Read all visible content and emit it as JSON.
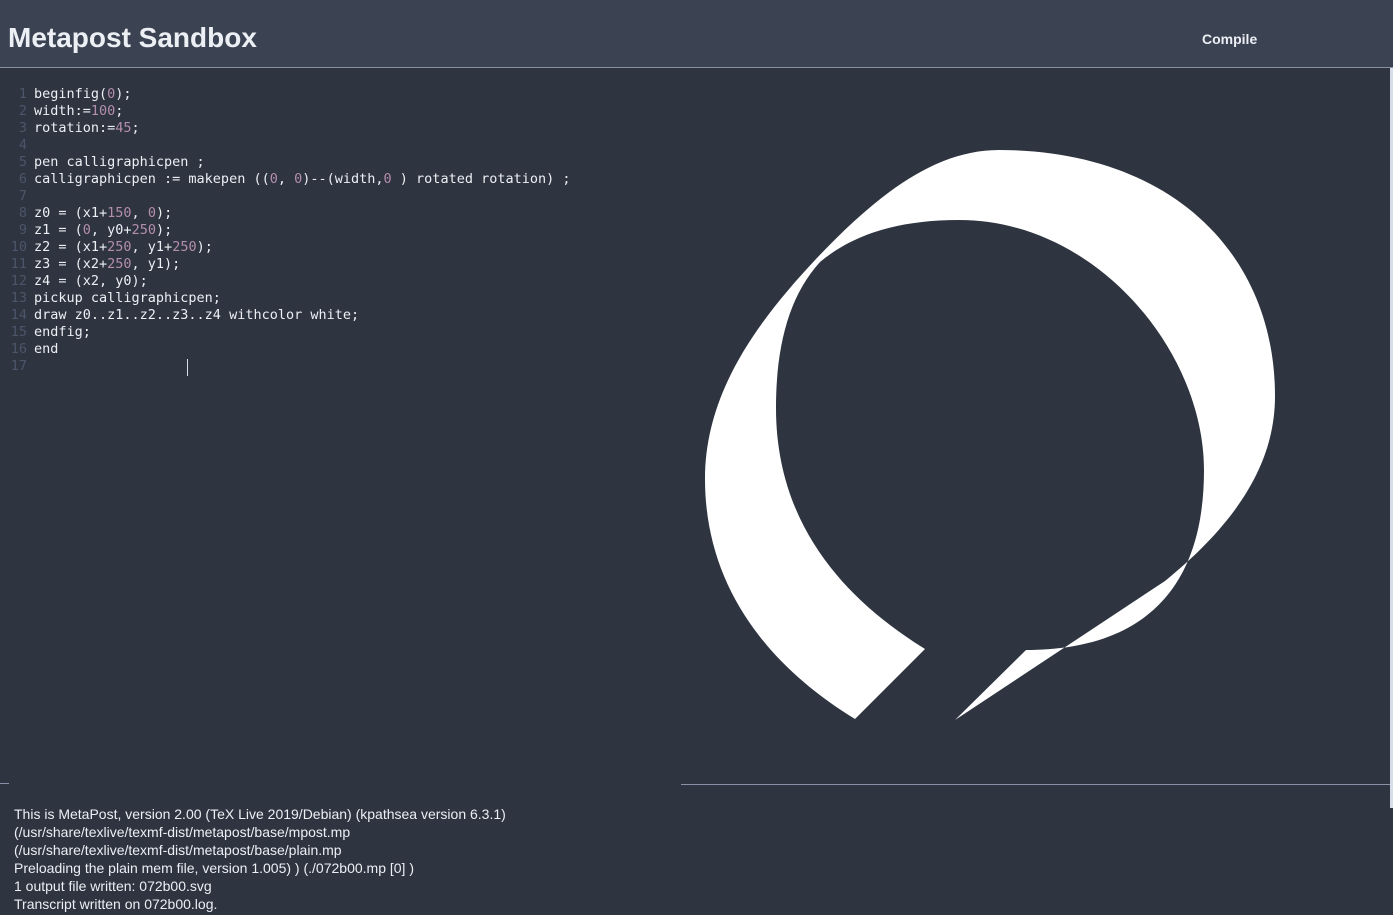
{
  "header": {
    "title": "Metapost Sandbox",
    "compile_label": "Compile"
  },
  "editor": {
    "lines": [
      {
        "n": "1",
        "parts": [
          [
            "beginfig(",
            "t"
          ],
          [
            "0",
            "n"
          ],
          [
            ");",
            "t"
          ]
        ]
      },
      {
        "n": "2",
        "parts": [
          [
            "width:=",
            "t"
          ],
          [
            "100",
            "n"
          ],
          [
            ";",
            "t"
          ]
        ]
      },
      {
        "n": "3",
        "parts": [
          [
            "rotation:=",
            "t"
          ],
          [
            "45",
            "n"
          ],
          [
            ";",
            "t"
          ]
        ]
      },
      {
        "n": "4",
        "parts": []
      },
      {
        "n": "5",
        "parts": [
          [
            "pen calligraphicpen ;",
            "t"
          ]
        ]
      },
      {
        "n": "6",
        "parts": [
          [
            "calligraphicpen := makepen ((",
            "t"
          ],
          [
            "0",
            "n"
          ],
          [
            ", ",
            "t"
          ],
          [
            "0",
            "n"
          ],
          [
            ")--(width,",
            "t"
          ],
          [
            "0",
            "n"
          ],
          [
            " ) rotated rotation) ;",
            "t"
          ]
        ]
      },
      {
        "n": "7",
        "parts": []
      },
      {
        "n": "8",
        "parts": [
          [
            "z0 = (x1+",
            "t"
          ],
          [
            "150",
            "n"
          ],
          [
            ", ",
            "t"
          ],
          [
            "0",
            "n"
          ],
          [
            ");",
            "t"
          ]
        ]
      },
      {
        "n": "9",
        "parts": [
          [
            "z1 = (",
            "t"
          ],
          [
            "0",
            "n"
          ],
          [
            ", y0+",
            "t"
          ],
          [
            "250",
            "n"
          ],
          [
            ");",
            "t"
          ]
        ]
      },
      {
        "n": "10",
        "parts": [
          [
            "z2 = (x1+",
            "t"
          ],
          [
            "250",
            "n"
          ],
          [
            ", y1+",
            "t"
          ],
          [
            "250",
            "n"
          ],
          [
            ");",
            "t"
          ]
        ]
      },
      {
        "n": "11",
        "parts": [
          [
            "z3 = (x2+",
            "t"
          ],
          [
            "250",
            "n"
          ],
          [
            ", y1);",
            "t"
          ]
        ]
      },
      {
        "n": "12",
        "parts": [
          [
            "z4 = (x2, y0);",
            "t"
          ]
        ]
      },
      {
        "n": "13",
        "parts": [
          [
            "pickup calligraphicpen;",
            "t"
          ]
        ]
      },
      {
        "n": "14",
        "parts": [
          [
            "draw z0..z1..z2..z3..z4 withcolor white;",
            "t"
          ]
        ]
      },
      {
        "n": "15",
        "parts": [
          [
            "endfig;",
            "t"
          ]
        ]
      },
      {
        "n": "16",
        "parts": [
          [
            "end",
            "t"
          ]
        ]
      },
      {
        "n": "17",
        "parts": []
      }
    ]
  },
  "console": {
    "lines": [
      "This is MetaPost, version 2.00 (TeX Live 2019/Debian) (kpathsea version 6.3.1)",
      "(/usr/share/texlive/texmf-dist/metapost/base/mpost.mp",
      "(/usr/share/texlive/texmf-dist/metapost/base/plain.mp",
      "Preloading the plain mem file, version 1.005) ) (./072b00.mp [0] )",
      "1 output file written: 072b00.svg",
      "Transcript written on 072b00.log."
    ]
  },
  "colors": {
    "background": "#2e3440",
    "header": "#3b4252",
    "text": "#eceff4",
    "number": "#b48ead",
    "line_number": "#4c566a",
    "figure": "#ffffff"
  }
}
